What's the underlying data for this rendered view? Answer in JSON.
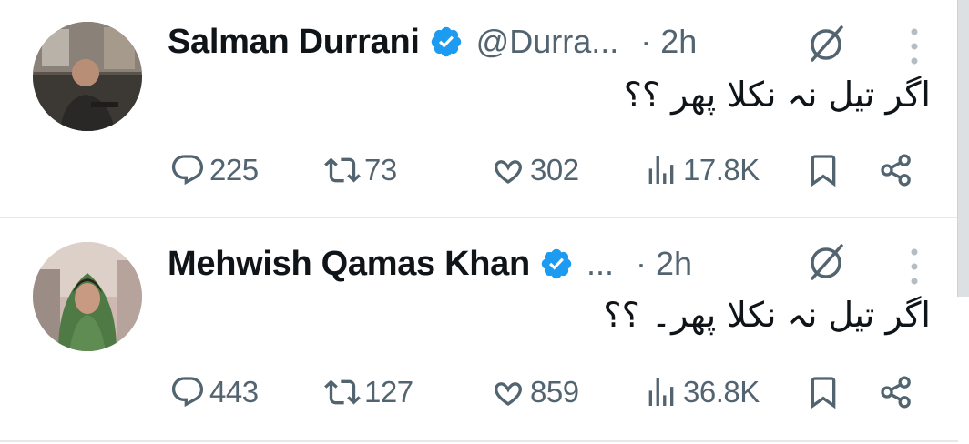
{
  "colors": {
    "verified": "#1d9bf0",
    "muted": "#536471",
    "text": "#0f1419",
    "divider": "#e6e9ec"
  },
  "tweets": [
    {
      "name": "Salman Durrani",
      "handle": "@Durra...",
      "dot": "·",
      "time": "2h",
      "text": "اگر تیل نہ نکلا پھر ؟؟",
      "replies": "225",
      "retweets": "73",
      "likes": "302",
      "views": "17.8K",
      "icons": [
        "verified-badge-icon",
        "grok-icon",
        "more-icon",
        "reply-icon",
        "retweet-icon",
        "like-icon",
        "views-icon",
        "bookmark-icon",
        "share-icon"
      ]
    },
    {
      "name": "Mehwish Qamas Khan",
      "handle": "...",
      "dot": "·",
      "time": "2h",
      "text": "اگر تیل نہ نکلا پھر۔ ؟؟",
      "replies": "443",
      "retweets": "127",
      "likes": "859",
      "views": "36.8K",
      "icons": [
        "verified-badge-icon",
        "grok-icon",
        "more-icon",
        "reply-icon",
        "retweet-icon",
        "like-icon",
        "views-icon",
        "bookmark-icon",
        "share-icon"
      ]
    }
  ]
}
